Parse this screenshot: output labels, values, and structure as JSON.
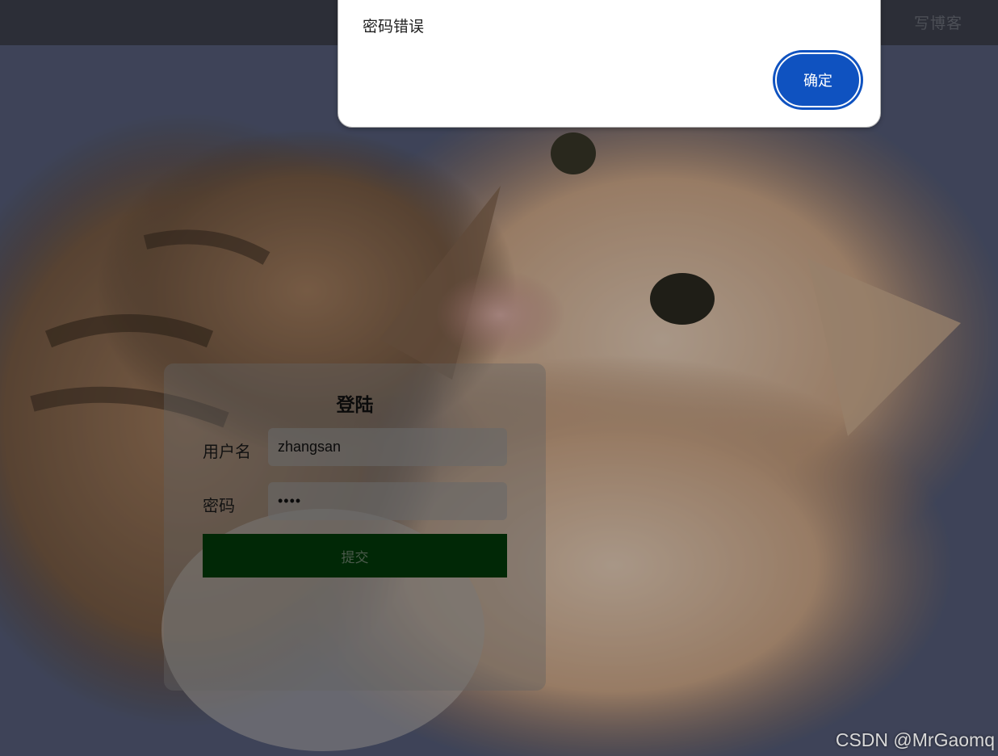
{
  "navbar": {
    "write_blog_label": "写博客"
  },
  "login": {
    "title": "登陆",
    "username_label": "用户名",
    "username_value": "zhangsan",
    "password_label": "密码",
    "password_value": "1234",
    "submit_label": "提交"
  },
  "alert": {
    "message": "密码错误",
    "ok_label": "确定"
  },
  "watermark": "CSDN @MrGaomq",
  "colors": {
    "submit_bg": "#023a0a",
    "ok_button_bg": "#0f52c0"
  }
}
